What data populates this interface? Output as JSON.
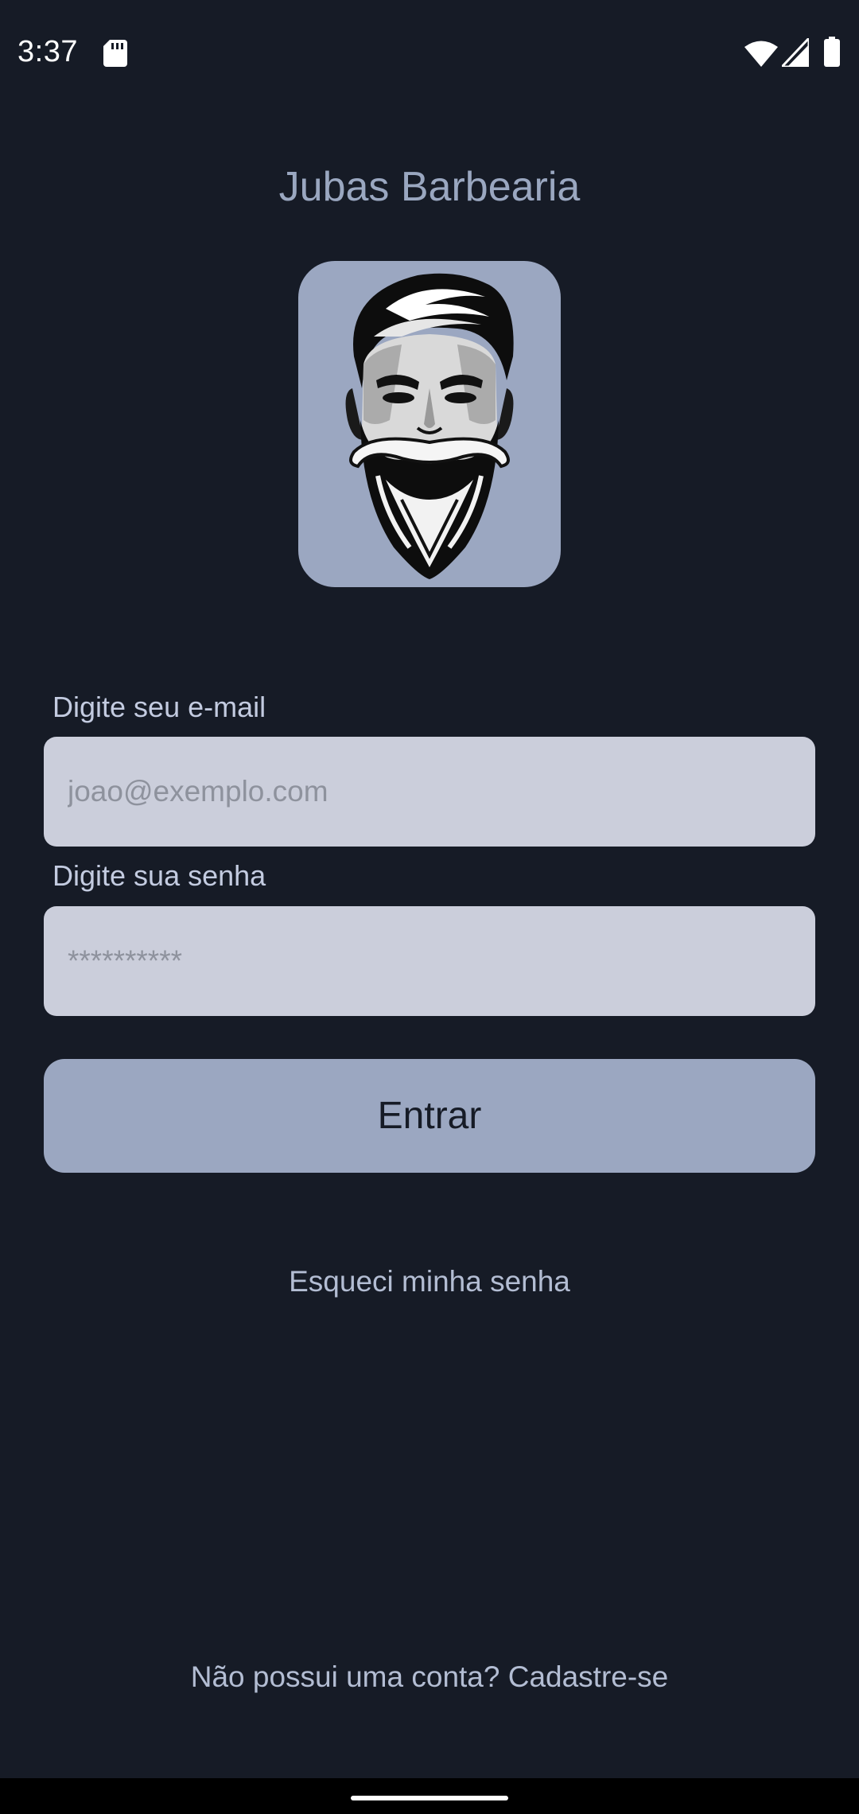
{
  "status_bar": {
    "time": "3:37",
    "icons": [
      "sd-card-icon",
      "wifi-icon",
      "signal-icon",
      "battery-icon"
    ]
  },
  "app": {
    "title": "Jubas Barbearia",
    "logo": "bearded-man-logo-icon"
  },
  "login_form": {
    "email_label": "Digite seu e-mail",
    "email_placeholder": "joao@exemplo.com",
    "email_value": "",
    "password_label": "Digite sua senha",
    "password_placeholder": "**********",
    "password_value": "",
    "submit_label": "Entrar"
  },
  "links": {
    "forgot_password": "Esqueci minha senha",
    "signup": "Não possui uma conta? Cadastre-se"
  },
  "colors": {
    "background": "#161b26",
    "accent": "#9ba7c1",
    "input_background": "#cbcedb",
    "text_muted": "#b3bdd3"
  }
}
